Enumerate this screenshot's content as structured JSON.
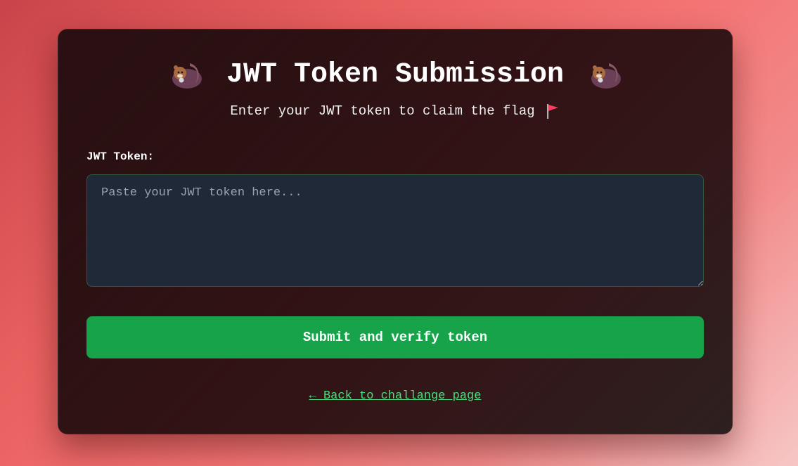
{
  "header": {
    "title": "JWT Token Submission",
    "left_icon": "otter-icon",
    "right_icon": "otter-icon",
    "subtitle": "Enter your JWT token to claim the flag",
    "subtitle_icon": "flag-icon"
  },
  "form": {
    "token_label": "JWT Token:",
    "token_value": "",
    "token_placeholder": "Paste your JWT token here...",
    "submit_label": "Submit and verify token"
  },
  "footer": {
    "back_link_label": "← Back to challange page"
  },
  "colors": {
    "submit_button": "#16a34a",
    "link": "#4ade80",
    "textarea_bg": "#1f2937",
    "card_bg": "#2a1012"
  }
}
